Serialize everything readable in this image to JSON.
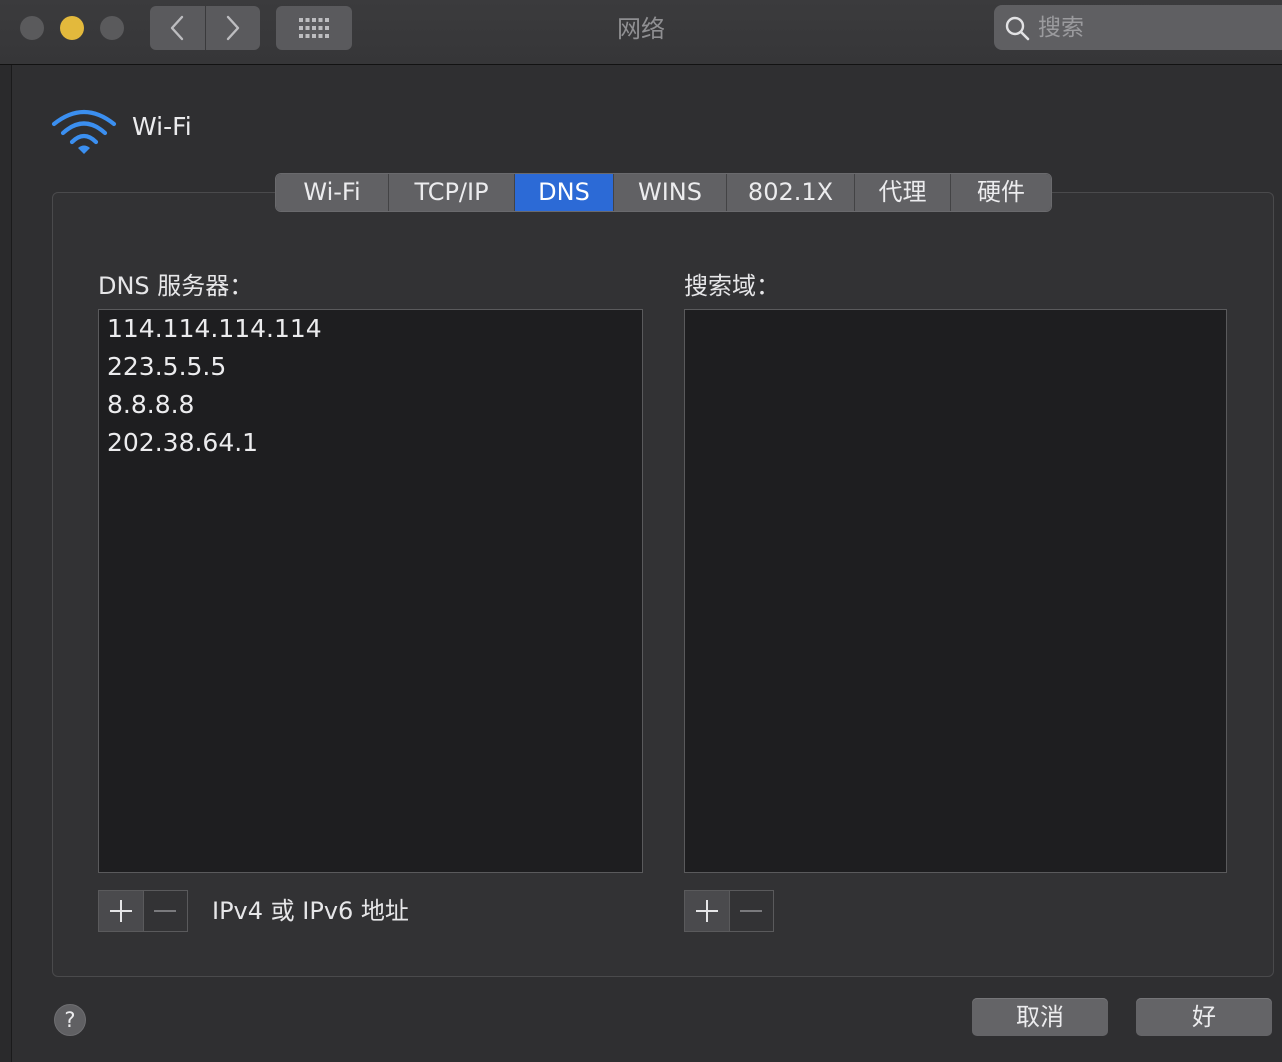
{
  "window": {
    "title": "网络"
  },
  "toolbar": {
    "back_icon": "chevron-left-icon",
    "forward_icon": "chevron-right-icon",
    "show_all_icon": "grid-icon",
    "search_placeholder": "搜索"
  },
  "interface": {
    "name": "Wi-Fi",
    "icon": "wifi-icon",
    "accent_color": "#3b8ff0"
  },
  "tabs": [
    {
      "label": "Wi-Fi",
      "active": false
    },
    {
      "label": "TCP/IP",
      "active": false
    },
    {
      "label": "DNS",
      "active": true
    },
    {
      "label": "WINS",
      "active": false
    },
    {
      "label": "802.1X",
      "active": false
    },
    {
      "label": "代理",
      "active": false
    },
    {
      "label": "硬件",
      "active": false
    }
  ],
  "dns": {
    "servers_label": "DNS 服务器：",
    "servers": [
      "114.114.114.114",
      "223.5.5.5",
      "8.8.8.8",
      "202.38.64.1"
    ],
    "servers_hint": "IPv4 或 IPv6 地址",
    "search_domains_label": "搜索域：",
    "search_domains": []
  },
  "footer": {
    "help_label": "?",
    "cancel_label": "取消",
    "ok_label": "好"
  }
}
